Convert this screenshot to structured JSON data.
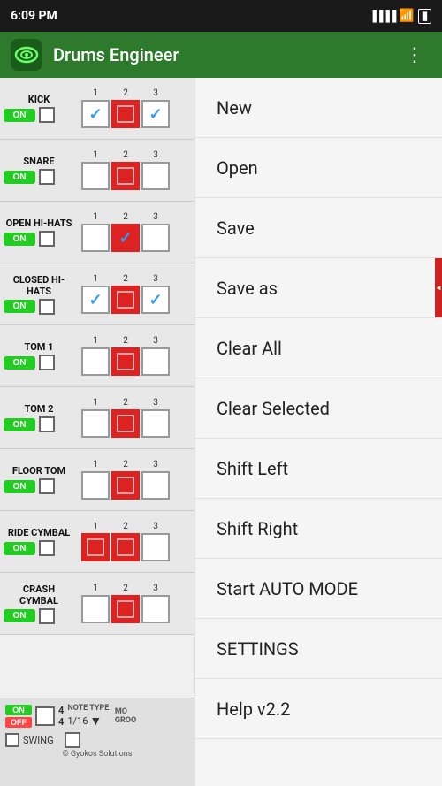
{
  "statusBar": {
    "time": "6:09 PM",
    "icons": [
      "signal",
      "wifi",
      "battery"
    ]
  },
  "appBar": {
    "title": "Drums Engineer",
    "menuIcon": "⋮"
  },
  "tracks": [
    {
      "name": "KICK",
      "on": true
    },
    {
      "name": "SNARE",
      "on": true
    },
    {
      "name": "OPEN HI-HATS",
      "on": true
    },
    {
      "name": "CLOSED HI-HATS",
      "on": true
    },
    {
      "name": "TOM 1",
      "on": true
    },
    {
      "name": "TOM 2",
      "on": true
    },
    {
      "name": "FLOOR TOM",
      "on": true
    },
    {
      "name": "RIDE CYMBAL",
      "on": true
    },
    {
      "name": "CRASH CYMBAL",
      "on": true
    }
  ],
  "beatNumbers": {
    "col1": "1",
    "col2": "2",
    "col3": "3"
  },
  "bottomControls": {
    "onLabel": "ON",
    "offLabel": "OFF",
    "timeSig": "4/4",
    "noteTypeLabel": "NOTE TYPE:",
    "noteValue": "1/16",
    "modeLabel": "MO",
    "grooveLabel": "GROO",
    "swingLabel": "SWING"
  },
  "menu": {
    "items": [
      {
        "id": "new",
        "label": "New"
      },
      {
        "id": "open",
        "label": "Open"
      },
      {
        "id": "save",
        "label": "Save"
      },
      {
        "id": "save-as",
        "label": "Save as"
      },
      {
        "id": "clear-all",
        "label": "Clear All"
      },
      {
        "id": "clear-selected",
        "label": "Clear Selected"
      },
      {
        "id": "shift-left",
        "label": "Shift Left"
      },
      {
        "id": "shift-right",
        "label": "Shift Right"
      },
      {
        "id": "auto-mode",
        "label": "Start AUTO MODE"
      },
      {
        "id": "settings",
        "label": "SETTINGS"
      },
      {
        "id": "help",
        "label": "Help v2.2"
      }
    ]
  },
  "copyright": "© Gyokos Solutions"
}
